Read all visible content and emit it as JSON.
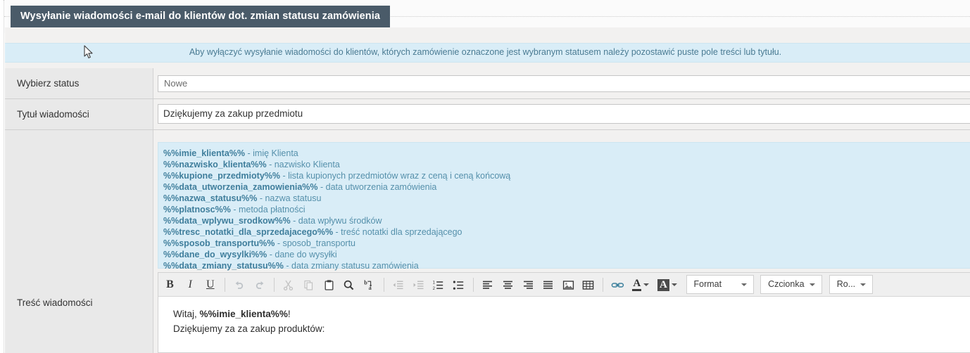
{
  "window": {
    "title": "Wysyłanie wiadomości e-mail do klientów dot. zmian statusu zamówienia"
  },
  "info": {
    "message": "Aby wyłączyć wysyłanie wiadomości do klientów, których zamówienie oznaczone jest wybranym statusem należy pozostawić puste pole treści lub tytułu."
  },
  "form": {
    "status": {
      "label": "Wybierz status",
      "value": "Nowe"
    },
    "subject": {
      "label": "Tytuł wiadomości",
      "value": "Dziękujemy za zakup przedmiotu"
    },
    "body": {
      "label": "Treść wiadomości"
    }
  },
  "variables": [
    {
      "token": "%%imie_klienta%%",
      "desc": " - imię Klienta"
    },
    {
      "token": "%%nazwisko_klienta%%",
      "desc": " - nazwisko Klienta"
    },
    {
      "token": "%%kupione_przedmioty%%",
      "desc": " - lista kupionych przedmiotów wraz z ceną i ceną końcową"
    },
    {
      "token": "%%data_utworzenia_zamowienia%%",
      "desc": " - data utworzenia zamówienia"
    },
    {
      "token": "%%nazwa_statusu%%",
      "desc": " - nazwa statusu"
    },
    {
      "token": "%%platnosc%%",
      "desc": " - metoda płatności"
    },
    {
      "token": "%%data_wplywu_srodkow%%",
      "desc": " - data wpływu środków"
    },
    {
      "token": "%%tresc_notatki_dla_sprzedajacego%%",
      "desc": " - treść notatki dla sprzedającego"
    },
    {
      "token": "%%sposob_transportu%%",
      "desc": " - sposob_transportu"
    },
    {
      "token": "%%dane_do_wysylki%%",
      "desc": " - dane do wysyłki"
    },
    {
      "token": "%%data_zmiany_statusu%%",
      "desc": " - data zmiany statusu zamówienia"
    }
  ],
  "editor": {
    "toolbar": {
      "bold": "B",
      "italic": "I",
      "underline": "U",
      "icons": [
        "bold-icon",
        "italic-icon",
        "underline-icon",
        "undo-icon",
        "redo-icon",
        "cut-icon",
        "copy-icon",
        "paste-icon",
        "find-icon",
        "replace-icon",
        "outdent-icon",
        "indent-icon",
        "numbered-list-icon",
        "bulleted-list-icon",
        "align-left-icon",
        "align-center-icon",
        "align-right-icon",
        "align-justify-icon",
        "image-icon",
        "table-icon",
        "link-icon",
        "text-color-icon",
        "background-color-icon"
      ],
      "text_color_glyph": "A",
      "background_color_glyph": "A",
      "format_label": "Format",
      "font_label": "Czcionka",
      "size_label": "Ro..."
    },
    "content": {
      "line1_prefix": "Witaj, ",
      "line1_token": "%%imie_klienta%%",
      "line1_suffix": "!",
      "line2": "Dziękujemy za za zakup produktów:"
    }
  },
  "colors": {
    "title_bar": "#4a5b69",
    "info_bg": "#d9edf7",
    "info_text": "#4a7b93",
    "label_bg": "#e9e9e9",
    "panel_bg": "#f2f1f0",
    "var_token": "#3f7e9c",
    "var_desc": "#5590ab"
  }
}
